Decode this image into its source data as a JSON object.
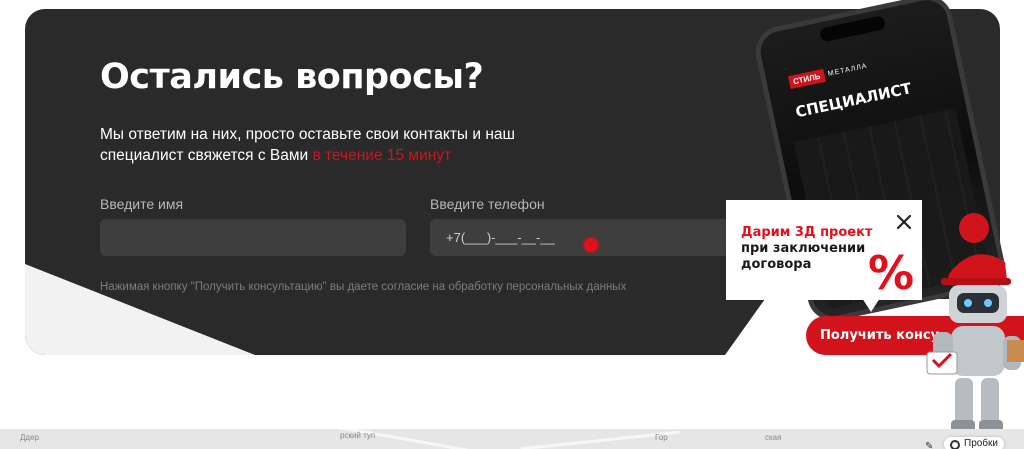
{
  "form": {
    "title": "Остались вопросы?",
    "description_main": "Мы ответим на них, просто оставьте свои контакты и наш специалист свяжется с Вами ",
    "description_highlight": "в течение 15 минут",
    "name_label": "Введите имя",
    "name_value": "",
    "phone_label": "Введите телефон",
    "phone_value": "+7(___)-___-__-__",
    "consent": "Нажимая кнопку \"Получить консультацию\" вы даете согласие на обработку персональных данных"
  },
  "phone_mockup": {
    "brand_badge": "СТИЛЬ",
    "brand_text": "МЕТАЛЛА",
    "heading": "СПЕЦИАЛИСТ"
  },
  "promo": {
    "line1": "Дарим 3Д проект",
    "line2": "при заключении",
    "line3": "договора",
    "percent_sign": "%",
    "close_icon": "close-icon"
  },
  "cta": {
    "label": "Получить консу"
  },
  "map": {
    "labels": [
      "Ддер",
      "рский туп",
      "Гор",
      "ская"
    ],
    "route_button": "Пробки"
  },
  "colors": {
    "card_bg": "#2a2a2a",
    "accent_red": "#d3131b",
    "input_bg": "#3e3e3e"
  }
}
